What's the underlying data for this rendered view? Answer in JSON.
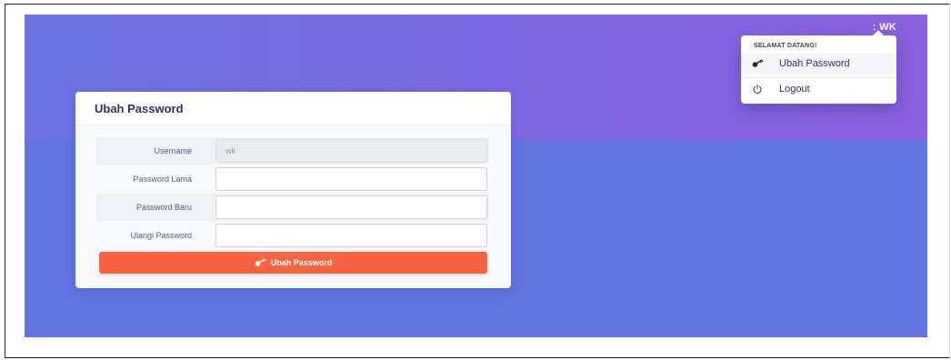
{
  "navbar": {
    "user_label": ": WK"
  },
  "dropdown": {
    "header": "SELAMAT DATANG!",
    "items": [
      {
        "label": "Ubah Password",
        "icon": "key-icon"
      },
      {
        "label": "Logout",
        "icon": "power-icon"
      }
    ]
  },
  "card": {
    "title": "Ubah Password",
    "fields": [
      {
        "label": "Username",
        "value": "wk",
        "placeholder": ""
      },
      {
        "label": "Password Lama",
        "value": "",
        "placeholder": ""
      },
      {
        "label": "Password Baru",
        "value": "",
        "placeholder": ""
      },
      {
        "label": "Ulangi Password",
        "value": "",
        "placeholder": ""
      }
    ],
    "submit_label": "Ubah Password",
    "submit_icon": "key-icon"
  },
  "colors": {
    "accent": "#fb6340",
    "background": "#5f73e3",
    "hero_start": "#6a72e2",
    "hero_end": "#8a5fe0",
    "text": "#32325d"
  }
}
